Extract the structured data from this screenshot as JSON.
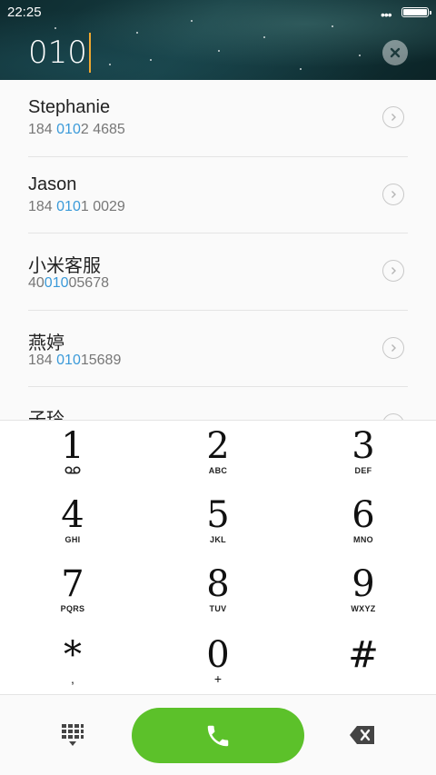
{
  "status_bar": {
    "time": "22:25",
    "more_dots": "•••"
  },
  "dialer": {
    "input_value": "010"
  },
  "contacts": [
    {
      "name": "Stephanie",
      "number_pre": "184 ",
      "number_match": "010",
      "number_post": "2 4685"
    },
    {
      "name": "Jason",
      "number_pre": "184 ",
      "number_match": "010",
      "number_post": "1 0029"
    },
    {
      "name": "小米客服",
      "number_pre": "40",
      "number_match": "010",
      "number_post": "05678"
    },
    {
      "name": "燕婷",
      "number_pre": "184 ",
      "number_match": "010",
      "number_post": "15689"
    },
    {
      "name": "子玲",
      "number_pre": "",
      "number_match": "",
      "number_post": ""
    }
  ],
  "keypad": {
    "keys": [
      {
        "digit": "1",
        "sub": ""
      },
      {
        "digit": "2",
        "sub": "ABC"
      },
      {
        "digit": "3",
        "sub": "DEF"
      },
      {
        "digit": "4",
        "sub": "GHI"
      },
      {
        "digit": "5",
        "sub": "JKL"
      },
      {
        "digit": "6",
        "sub": "MNO"
      },
      {
        "digit": "7",
        "sub": "PQRS"
      },
      {
        "digit": "8",
        "sub": "TUV"
      },
      {
        "digit": "9",
        "sub": "WXYZ"
      },
      {
        "digit": "*",
        "sub": ","
      },
      {
        "digit": "0",
        "sub": "+"
      },
      {
        "digit": "#",
        "sub": ""
      }
    ]
  },
  "colors": {
    "accent_highlight": "#3a9ad9",
    "call_green": "#5cc12a",
    "cursor": "#f0a830"
  },
  "icons": {
    "clear": "clear-circle-icon",
    "row_arrow": "chevron-right-circle-icon",
    "voicemail": "voicemail-icon",
    "dialpad": "dialpad-grid-icon",
    "call": "phone-icon",
    "backspace": "backspace-icon"
  }
}
